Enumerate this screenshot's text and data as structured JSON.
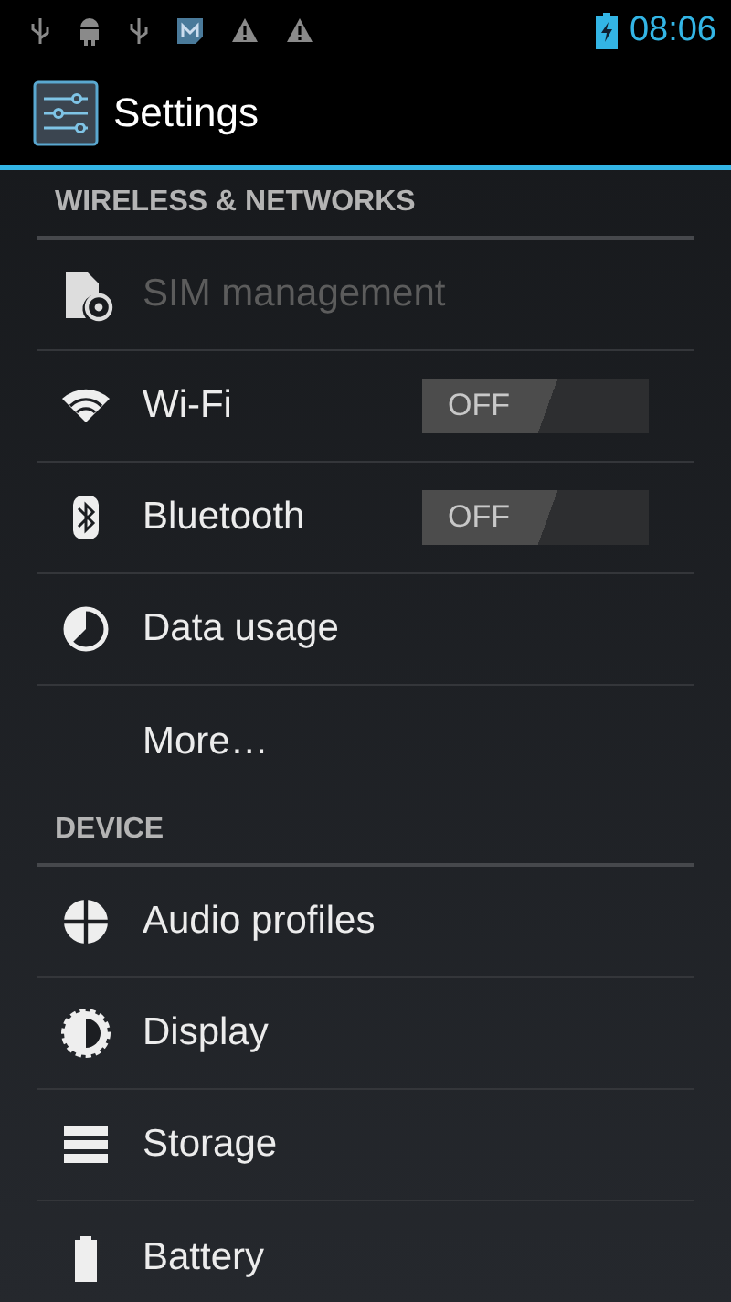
{
  "status_bar": {
    "time": "08:06"
  },
  "action_bar": {
    "title": "Settings"
  },
  "sections": [
    {
      "header": "WIRELESS & NETWORKS",
      "items": [
        {
          "label": "SIM management",
          "kind": "plain",
          "disabled": true
        },
        {
          "label": "Wi-Fi",
          "kind": "toggle",
          "disabled": false,
          "toggle": {
            "label": "OFF",
            "on": false
          }
        },
        {
          "label": "Bluetooth",
          "kind": "toggle",
          "disabled": false,
          "toggle": {
            "label": "OFF",
            "on": false
          }
        },
        {
          "label": "Data usage",
          "kind": "plain",
          "disabled": false
        },
        {
          "label": "More…",
          "kind": "plain",
          "disabled": false
        }
      ]
    },
    {
      "header": "DEVICE",
      "items": [
        {
          "label": "Audio profiles",
          "kind": "plain",
          "disabled": false
        },
        {
          "label": "Display",
          "kind": "plain",
          "disabled": false
        },
        {
          "label": "Storage",
          "kind": "plain",
          "disabled": false
        },
        {
          "label": "Battery",
          "kind": "plain",
          "disabled": false
        }
      ]
    }
  ]
}
